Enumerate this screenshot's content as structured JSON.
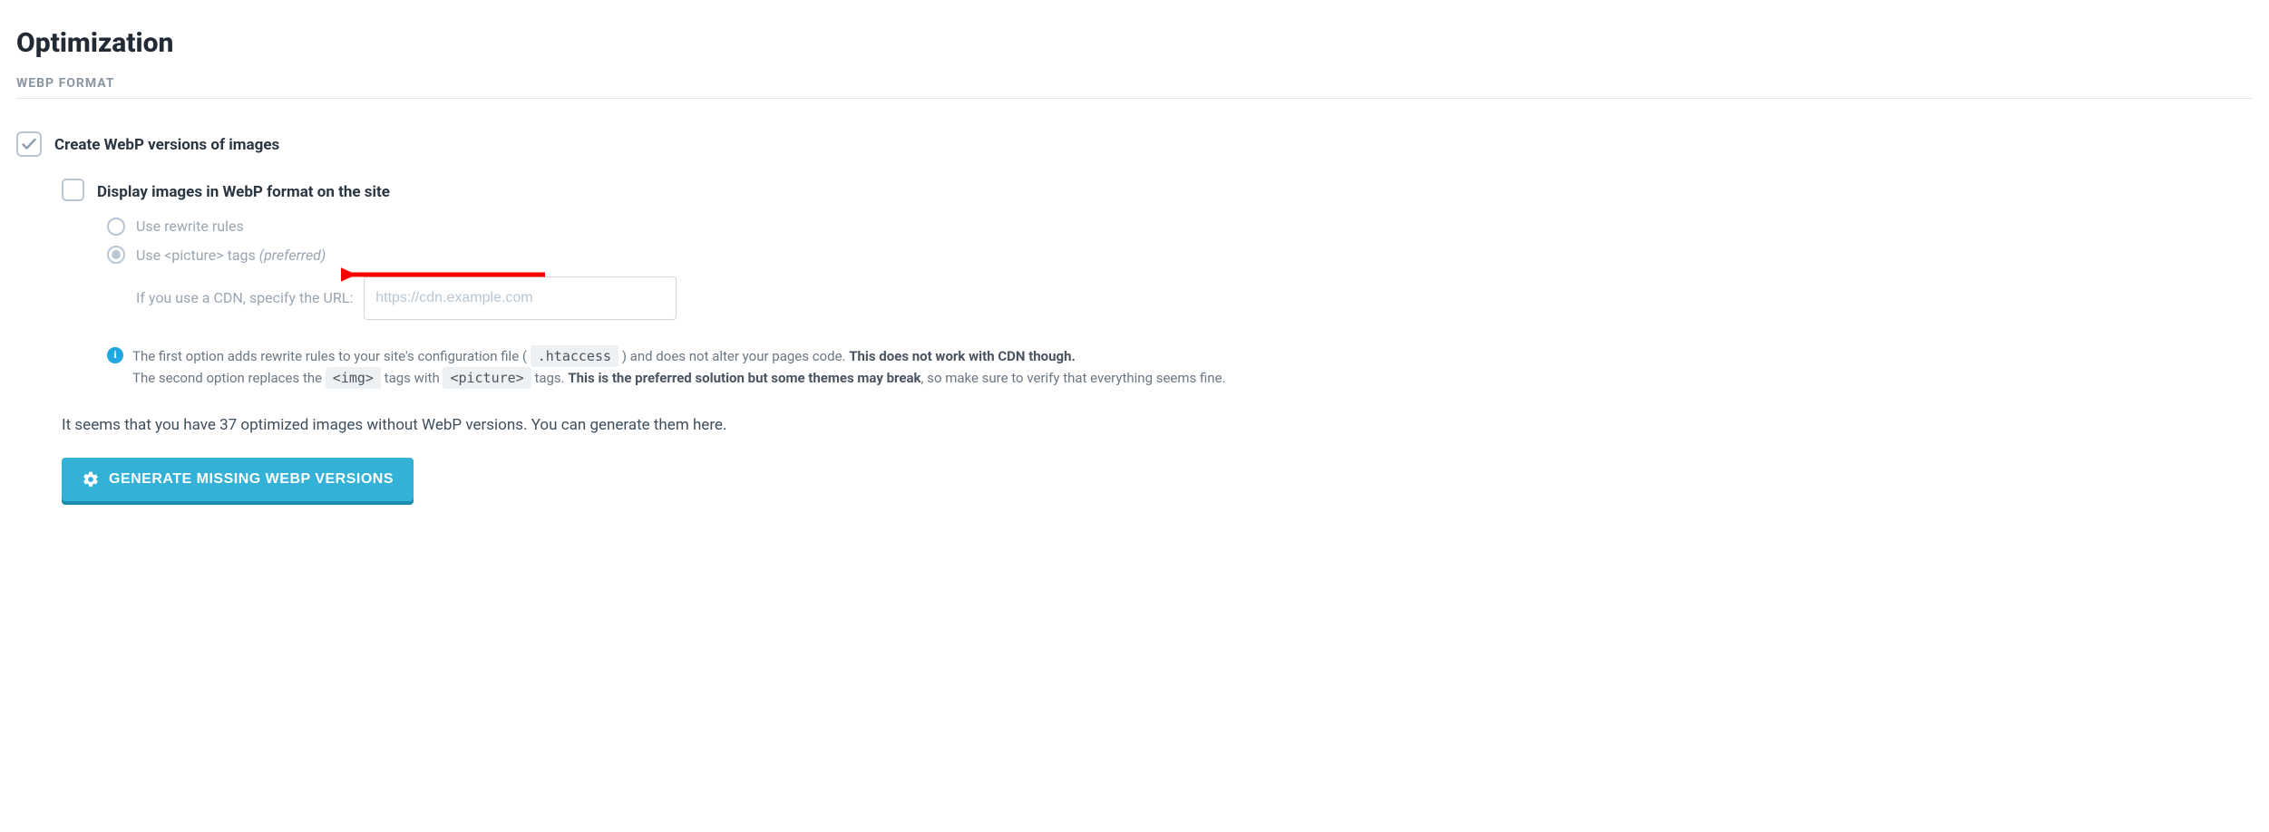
{
  "page": {
    "title": "Optimization",
    "subtitle": "WEBP FORMAT"
  },
  "options": {
    "create_webp_label": "Create WebP versions of images",
    "display_webp_label": "Display images in WebP format on the site"
  },
  "radios": {
    "rewrite_label": "Use rewrite rules",
    "picture_label": "Use <picture> tags ",
    "picture_suffix": "(preferred)"
  },
  "cdn": {
    "label": "If you use a CDN, specify the URL:",
    "placeholder": "https://cdn.example.com"
  },
  "info": {
    "line1_a": "The first option adds rewrite rules to your site's configuration file ( ",
    "line1_code": ".htaccess",
    "line1_b": " ) and does not alter your pages code. ",
    "line1_strong": "This does not work with CDN though.",
    "line2_a": "The second option replaces the ",
    "line2_code1": "<img>",
    "line2_b": " tags with ",
    "line2_code2": "<picture>",
    "line2_c": " tags. ",
    "line2_strong": "This is the preferred solution but some themes may break",
    "line2_d": ", so make sure to verify that everything seems fine."
  },
  "status": "It seems that you have 37 optimized images without WebP versions. You can generate them here.",
  "button": {
    "generate_label": "GENERATE MISSING WEBP VERSIONS"
  }
}
